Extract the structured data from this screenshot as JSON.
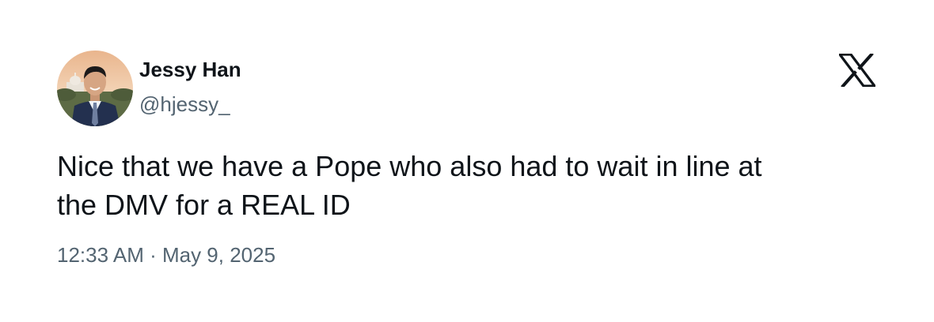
{
  "author": {
    "display_name": "Jessy Han",
    "handle": "@hjessy_"
  },
  "platform": {
    "logo_icon": "x-logo-icon"
  },
  "tweet": {
    "text_line_1": "Nice that we have a Pope who also had to wait in line at",
    "text_line_2": "the DMV for a REAL ID",
    "timestamp": "12:33 AM · May 9, 2025"
  },
  "colors": {
    "primary_text": "#0f1419",
    "secondary_text": "#536471",
    "background": "#ffffff"
  }
}
